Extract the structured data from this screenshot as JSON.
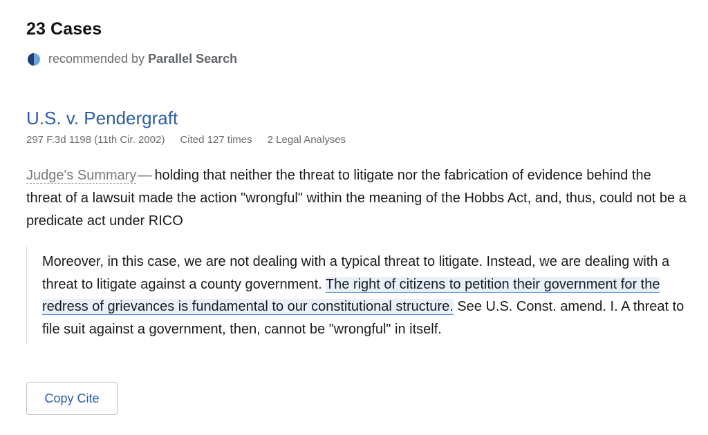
{
  "header": {
    "count_label": "23 Cases",
    "recommended_prefix": "recommended by",
    "recommended_brand": "Parallel Search",
    "icon": "half-circle-icon"
  },
  "case": {
    "title": "U.S. v. Pendergraft",
    "citation": "297 F.3d 1198 (11th Cir. 2002)",
    "cited": "Cited 127 times",
    "analyses": "2 Legal Analyses",
    "summary_label": "Judge's Summary",
    "summary_dash": "—",
    "summary_text": "holding that neither the threat to litigate nor the fabrication of evidence behind the threat of a lawsuit made the action \"wrongful\" within the meaning of the Hobbs Act, and, thus, could not be a predicate act under RICO",
    "quote_before": "Moreover, in this case, we are not dealing with a typical threat to litigate. Instead, we are dealing with a threat to litigate against a county government. ",
    "quote_highlight": "The right of citizens to petition their government for the redress of grievances is fundamental to our constitutional structure.",
    "quote_after": " See U.S. Const. amend. I. A threat to file suit against a government, then, cannot be \"wrongful\" in itself.",
    "copy_cite_label": "Copy Cite"
  },
  "colors": {
    "link": "#2b5ea8",
    "highlight_bg": "#e8f1fb",
    "highlight_underline": "#5b93d6"
  }
}
